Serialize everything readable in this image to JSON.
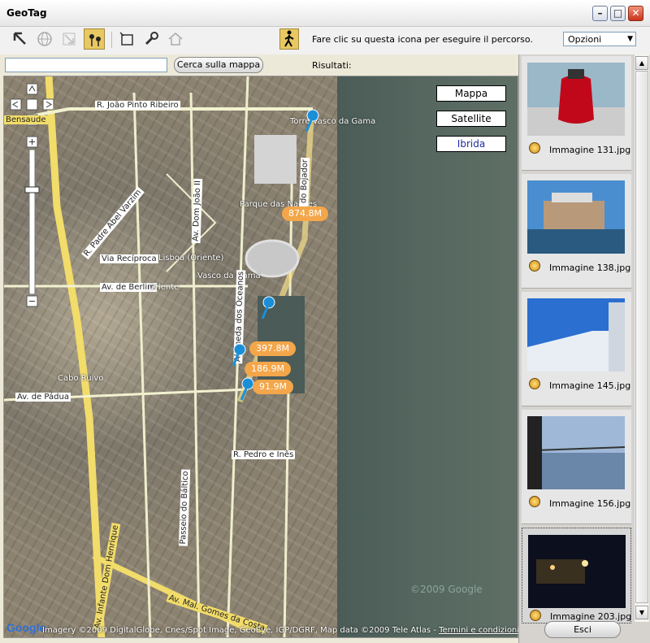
{
  "window": {
    "title": "GeoTag"
  },
  "toolbar": {
    "hint": "Fare clic su questa icona per eseguire il percorso.",
    "options_label": "Opzioni"
  },
  "search": {
    "value": "",
    "button_label": "Cerca sulla mappa",
    "results_label": "Risultati:"
  },
  "map": {
    "types": [
      "Mappa",
      "Satellite",
      "Ibrida"
    ],
    "selected_type": "Ibrida",
    "distances": [
      "874.8M",
      "397.8M",
      "186.9M",
      "91.9M"
    ],
    "street_labels": [
      "Bensaude",
      "R. João Pinto Ribeiro",
      "Torre Vasco da Gama",
      "Parque das Nações",
      "Via Recíproca",
      "Lisboa (Oriente)",
      "Vasco da Gama",
      "Av. de Berlim",
      "Oriente",
      "Cabo Ruivo",
      "Av. de Pádua",
      "R. Pedro e Inês",
      "Av. Mal. Gomes da Costa",
      "Av. Infante Dom Henrique",
      "Alameda dos Oceanos",
      "R. do Bojador",
      "Passeio do Báltico",
      "Av. Dom João II",
      "R. Padre Abel Varzim"
    ],
    "copyright": "Imagery ©2009 DigitalGlobe, Cnes/Spot Image, GeoEye, IGP/DGRF, Map data ©2009 Tele Atlas - ",
    "terms_link": "Termini e condizioni d'uso",
    "google_logo": "Google",
    "watermark": "©2009 Google"
  },
  "photos": [
    {
      "label": "Immagine 131.jpg"
    },
    {
      "label": "Immagine 138.jpg"
    },
    {
      "label": "Immagine 145.jpg"
    },
    {
      "label": "Immagine 156.jpg"
    },
    {
      "label": "Immagine 203.jpg"
    }
  ],
  "footer": {
    "exit_label": "Esci"
  },
  "colors": {
    "route": "#f0e68c",
    "distance_badge": "#f3a64a",
    "selected_tool": "#e8c862"
  }
}
